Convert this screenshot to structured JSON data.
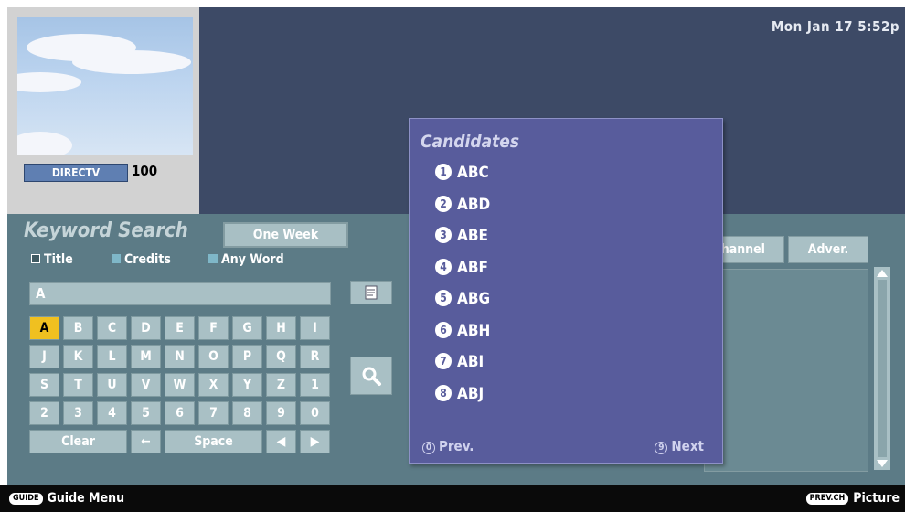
{
  "clock": "Mon Jan 17  5:52p",
  "preview": {
    "channel_name": "DIRECTV",
    "channel_number": "100"
  },
  "keyword_search": {
    "title": "Keyword Search",
    "period_button": "One Week",
    "options": [
      {
        "label": "Title",
        "selected": true
      },
      {
        "label": "Credits",
        "selected": false
      },
      {
        "label": "Any Word",
        "selected": false
      }
    ],
    "input_value": "A",
    "keyboard_rows": [
      [
        "A",
        "B",
        "C",
        "D",
        "E",
        "F",
        "G",
        "H",
        "I"
      ],
      [
        "J",
        "K",
        "L",
        "M",
        "N",
        "O",
        "P",
        "Q",
        "R"
      ],
      [
        "S",
        "T",
        "U",
        "V",
        "W",
        "X",
        "Y",
        "Z",
        "1"
      ],
      [
        "2",
        "3",
        "4",
        "5",
        "6",
        "7",
        "8",
        "9",
        "0"
      ]
    ],
    "active_key": "A",
    "bottom_keys": {
      "clear": "Clear",
      "backspace": "←",
      "space": "Space",
      "left": "◀",
      "right": "▶"
    }
  },
  "tabs": {
    "channel": "Channel",
    "adver": "Adver."
  },
  "candidates": {
    "title": "Candidates",
    "items": [
      {
        "num": "1",
        "text": "ABC"
      },
      {
        "num": "2",
        "text": "ABD"
      },
      {
        "num": "3",
        "text": "ABE"
      },
      {
        "num": "4",
        "text": "ABF"
      },
      {
        "num": "5",
        "text": "ABG"
      },
      {
        "num": "6",
        "text": "ABH"
      },
      {
        "num": "7",
        "text": "ABI"
      },
      {
        "num": "8",
        "text": "ABJ"
      }
    ],
    "prev_num": "0",
    "prev_label": "Prev.",
    "next_num": "9",
    "next_label": "Next"
  },
  "status": {
    "left_button": "GUIDE",
    "left_label": "Guide Menu",
    "right_button": "PREV.CH",
    "right_label": "Picture"
  },
  "colors": {
    "accent_key": "#f0c020",
    "panel": "#585c9c",
    "background_top": "#3d4a66",
    "background_bottom": "#5c7b86"
  }
}
